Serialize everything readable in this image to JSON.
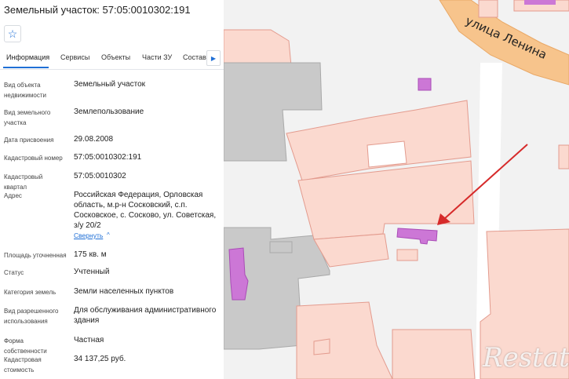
{
  "panel": {
    "title": "Земельный участок: 57:05:0010302:191",
    "tabs": [
      "Информация",
      "Сервисы",
      "Объекты",
      "Части ЗУ",
      "Состав"
    ],
    "fields": [
      {
        "label": "Вид объекта недвижимости",
        "value": "Земельный участок"
      },
      {
        "label": "Вид земельного участка",
        "value": "Землепользование"
      },
      {
        "label": "Дата присвоения",
        "value": "29.08.2008"
      },
      {
        "label": "Кадастровый номер",
        "value": "57:05:0010302:191"
      },
      {
        "label": "Кадастровый квартал",
        "value": "57:05:0010302"
      },
      {
        "label": "Адрес",
        "value": "Российская Федерация, Орловская область, м.р-н Сосковский, с.п. Сосковское, с. Сосково, ул. Советская, з/у 20/2"
      },
      {
        "label": "Площадь уточненная",
        "value": "175 кв. м"
      },
      {
        "label": "Статус",
        "value": "Учтенный"
      },
      {
        "label": "Категория земель",
        "value": "Земли населенных пунктов"
      },
      {
        "label": "Вид разрешенного использования",
        "value": "Для обслуживания административного здания"
      },
      {
        "label": "Форма собственности",
        "value": "Частная"
      },
      {
        "label": "Кадастровая стоимость",
        "value": "34 137,25 руб."
      }
    ],
    "collapse_link": "Свернуть",
    "icons": {
      "favorite": "star-icon",
      "tabs_next": "chevron-right-icon",
      "collapse": "chevron-up-icon"
    }
  },
  "map": {
    "street_label": "улица Ленина",
    "watermark": "Restate",
    "colors": {
      "parcel_fill": "#fbd9cf",
      "parcel_stroke": "#e39b8e",
      "building_gray": "#c9c9c9",
      "highlight": "#cc77d6",
      "road_orange": "#f7c48c",
      "arrow": "#d62a2a"
    }
  }
}
